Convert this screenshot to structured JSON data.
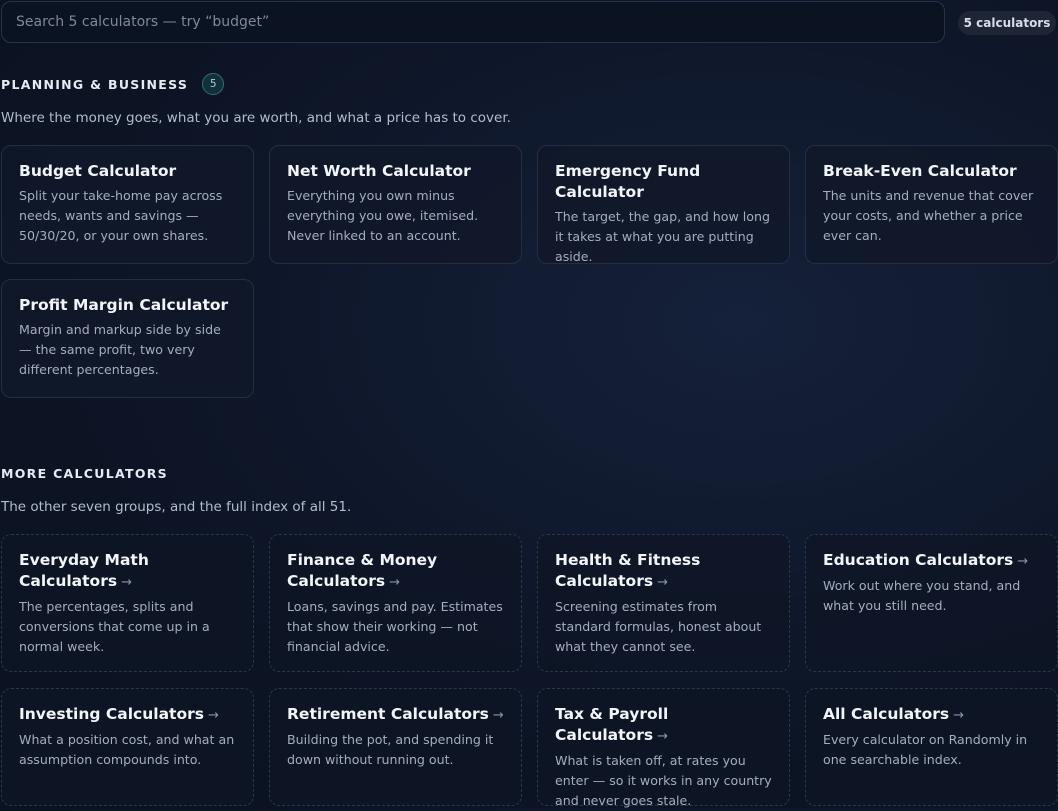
{
  "search": {
    "placeholder": "Search 5 calculators — try “budget”",
    "count": "5 calculators"
  },
  "planning": {
    "title": "PLANNING & BUSINESS",
    "count": "5",
    "description": "Where the money goes, what you are worth, and what a price has to cover.",
    "cards": [
      {
        "title": "Budget Calculator",
        "desc": "Split your take-home pay across needs, wants and savings — 50/30/20, or your own shares."
      },
      {
        "title": "Net Worth Calculator",
        "desc": "Everything you own minus everything you owe, itemised. Never linked to an account."
      },
      {
        "title": "Emergency Fund Calculator",
        "desc": "The target, the gap, and how long it takes at what you are putting aside."
      },
      {
        "title": "Break-Even Calculator",
        "desc": "The units and revenue that cover your costs, and whether a price ever can."
      },
      {
        "title": "Profit Margin Calculator",
        "desc": "Margin and markup side by side — the same profit, two very different percentages."
      }
    ]
  },
  "more": {
    "title": "MORE CALCULATORS",
    "description": "The other seven groups, and the full index of all 51.",
    "arrow": "→",
    "cards": [
      {
        "title": "Everyday Math Calculators",
        "desc": "The percentages, splits and conversions that come up in a normal week."
      },
      {
        "title": "Finance & Money Calculators",
        "desc": "Loans, savings and pay. Estimates that show their working — not financial advice."
      },
      {
        "title": "Health & Fitness Calculators",
        "desc": "Screening estimates from standard formulas, honest about what they cannot see."
      },
      {
        "title": "Education Calculators",
        "desc": "Work out where you stand, and what you still need."
      },
      {
        "title": "Investing Calculators",
        "desc": "What a position cost, and what an assumption compounds into."
      },
      {
        "title": "Retirement Calculators",
        "desc": "Building the pot, and spending it down without running out."
      },
      {
        "title": "Tax & Payroll Calculators",
        "desc": "What is taken off, at rates you enter — so it works in any country and never goes stale."
      },
      {
        "title": "All Calculators",
        "desc": "Every calculator on Randomly in one searchable index."
      }
    ]
  }
}
